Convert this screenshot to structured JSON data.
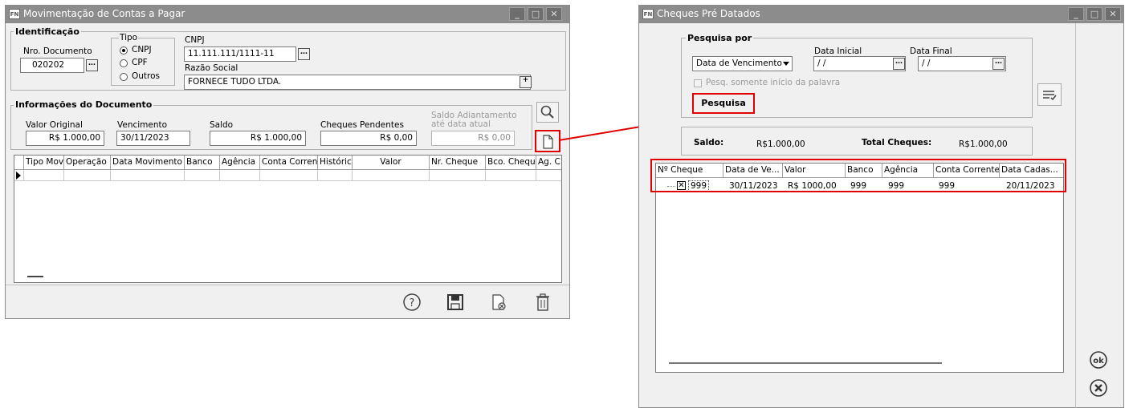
{
  "window1": {
    "title": "Movimentação de Contas a Pagar",
    "identificacao": {
      "legend": "Identificação",
      "nro_documento_label": "Nro. Documento",
      "nro_documento_value": "020202",
      "tipo_label": "Tipo",
      "tipo_options": [
        "CNPJ",
        "CPF",
        "Outros"
      ],
      "tipo_selected": "CNPJ",
      "cnpj_label": "CNPJ",
      "cnpj_value": "11.111.111/1111-11",
      "razao_social_label": "Razão Social",
      "razao_social_value": "FORNECE TUDO LTDA."
    },
    "documento": {
      "legend": "Informações do Documento",
      "valor_original_label": "Valor Original",
      "valor_original_value": "R$ 1.000,00",
      "vencimento_label": "Vencimento",
      "vencimento_value": "30/11/2023",
      "saldo_label": "Saldo",
      "saldo_value": "R$ 1.000,00",
      "cheques_pendentes_label": "Cheques Pendentes",
      "cheques_pendentes_value": "R$ 0,00",
      "saldo_adiantamento_label_1": "Saldo Adiantamento",
      "saldo_adiantamento_label_2": "até data atual",
      "saldo_adiantamento_value": "R$ 0,00"
    },
    "grid_columns": [
      "Tipo Mov.",
      "Operação",
      "Data Movimento",
      "Banco",
      "Agência",
      "Conta Corrente",
      "Histórico",
      "Valor",
      "Nr. Cheque",
      "Bco. Cheque",
      "Ag. C"
    ]
  },
  "window2": {
    "title": "Cheques Pré Datados",
    "pesquisa": {
      "legend": "Pesquisa por",
      "campo_value": "Data de Vencimento",
      "data_inicial_label": "Data Inicial",
      "data_inicial_value": "/ /",
      "data_final_label": "Data Final",
      "data_final_value": "/ /",
      "checkbox_label": "Pesq. somente início da palavra",
      "button_label": "Pesquisa"
    },
    "summary": {
      "saldo_label": "Saldo:",
      "saldo_value": "R$1.000,00",
      "total_label": "Total Cheques:",
      "total_value": "R$1.000,00"
    },
    "grid_columns": [
      "Nº Cheque",
      "Data de Ve...",
      "Valor",
      "Banco",
      "Agência",
      "Conta Corrente",
      "Data Cadas..."
    ],
    "rows": [
      {
        "nr_cheque": "999",
        "data_vencimento": "30/11/2023",
        "valor": "R$ 1000,00",
        "banco": "999",
        "agencia": "999",
        "conta_corrente": "999",
        "data_cadastro": "20/11/2023",
        "checked": true
      }
    ],
    "ok_label": "ok"
  },
  "colors": {
    "titlebar": "#8c8c8c",
    "highlight": "#e00000",
    "window_bg": "#f0f0f0"
  },
  "icons": [
    "search-icon",
    "new-document-icon",
    "help-icon",
    "save-icon",
    "cancel-document-icon",
    "trash-icon",
    "ok-icon",
    "close-icon",
    "list-check-icon"
  ]
}
